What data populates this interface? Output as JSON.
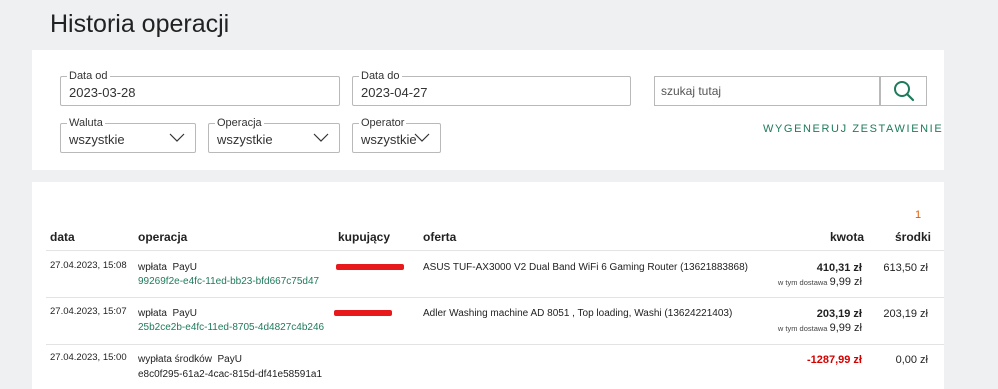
{
  "page": {
    "title": "Historia operacji"
  },
  "filters": {
    "date_from": {
      "label": "Data od",
      "value": "2023-03-28"
    },
    "date_to": {
      "label": "Data do",
      "value": "2023-04-27"
    },
    "search": {
      "placeholder": "szukaj tutaj"
    },
    "currency": {
      "label": "Waluta",
      "value": "wszystkie"
    },
    "operation": {
      "label": "Operacja",
      "value": "wszystkie"
    },
    "operator": {
      "label": "Operator",
      "value": "wszystkie"
    },
    "generate_label": "WYGENERUJ ZESTAWIENIE"
  },
  "pagination": {
    "current": "1"
  },
  "table": {
    "headers": {
      "date": "data",
      "operation": "operacja",
      "buyer": "kupujący",
      "offer": "oferta",
      "amount": "kwota",
      "balance": "środki"
    },
    "rows": [
      {
        "date": "27.04.2023, 15:08",
        "operation": "wpłata",
        "operator": "PayU",
        "tx_id": "99269f2e-e4fc-11ed-bb23-bfd667c75d47",
        "offer": "ASUS TUF-AX3000 V2 Dual Band WiFi 6 Gaming Router (13621883868)",
        "amount": "410,31 zł",
        "delivery_label": "w tym dostawa",
        "delivery_value": "9,99 zł",
        "balance": "613,50 zł"
      },
      {
        "date": "27.04.2023, 15:07",
        "operation": "wpłata",
        "operator": "PayU",
        "tx_id": "25b2ce2b-e4fc-11ed-8705-4d4827c4b246",
        "offer": "Adler Washing machine AD 8051 , Top loading, Washi (13624221403)",
        "amount": "203,19 zł",
        "delivery_label": "w tym dostawa",
        "delivery_value": "9,99 zł",
        "balance": "203,19 zł"
      },
      {
        "date": "27.04.2023, 15:00",
        "operation": "wypłata środków",
        "operator": "PayU",
        "tx_id": "e8c0f295-61a2-4cac-815d-df41e58591a1",
        "offer": "",
        "amount": "-1287,99 zł",
        "balance": "0,00 zł"
      }
    ]
  },
  "colors": {
    "accent": "#1f7a5c",
    "negative": "#d40000",
    "redaction": "#e8191b",
    "page_number": "#e05a00"
  }
}
